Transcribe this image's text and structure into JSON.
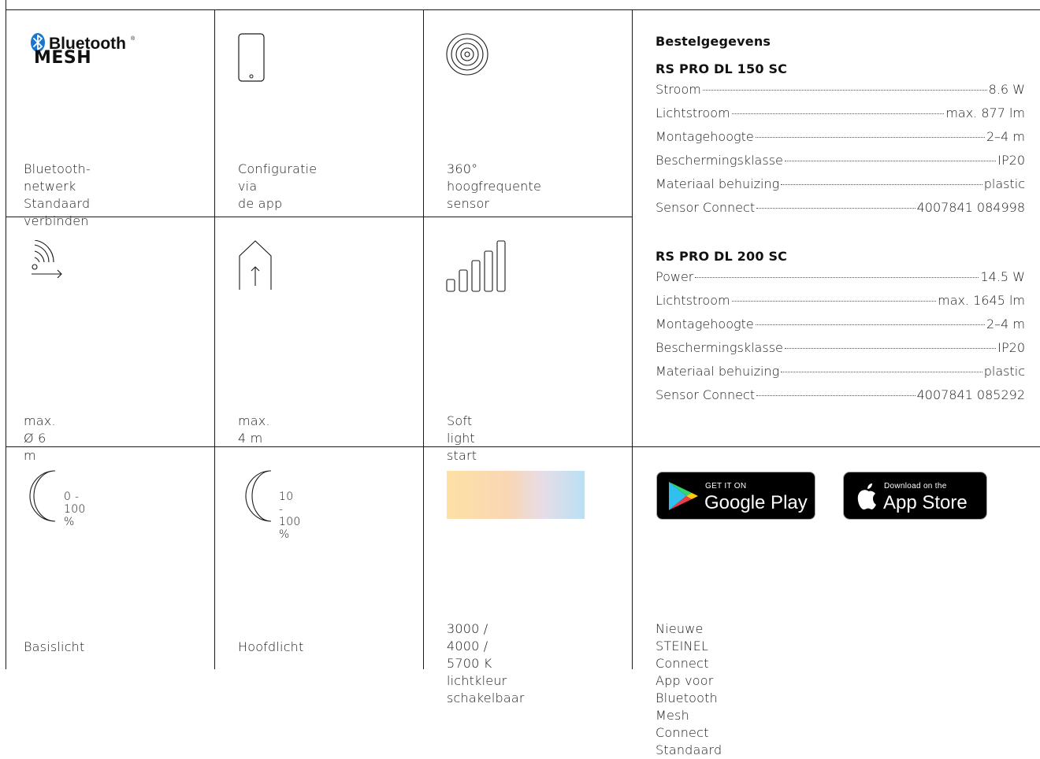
{
  "features": {
    "bluetooth": {
      "logo_word": "Bluetooth",
      "logo_reg": "®",
      "logo_mesh": "MESH",
      "caption": "Bluetooth-netwerk\nStandaard verbinden",
      "icon": "bluetooth-mesh-logo"
    },
    "app_config": {
      "caption": "Configuratie via\nde app",
      "icon": "smartphone-icon"
    },
    "sensor": {
      "caption": "360° hoogfrequente\nsensor",
      "icon": "hf-sensor-icon"
    },
    "range": {
      "caption": "max. Ø 6 m",
      "icon": "detection-range-icon"
    },
    "height": {
      "caption": "max. 4 m",
      "icon": "mounting-height-icon"
    },
    "soft_start": {
      "caption": "Soft light start",
      "icon": "soft-start-bars-icon"
    },
    "base_light": {
      "caption": "Basislicht",
      "range_label": "0 - 100 %",
      "icon": "moon-icon"
    },
    "main_light": {
      "caption": "Hoofdlicht",
      "range_label": "10 - 100 %",
      "icon": "moon-icon"
    },
    "color_temp": {
      "caption": "3000 / 4000 / 5700 K\nlichtkleur schakelbaar",
      "gradient_colors": [
        "#fde1a5",
        "#f9d6b5",
        "#e6dde8",
        "#b9e0f4"
      ]
    },
    "app_stores": {
      "google_small": "GET IT ON",
      "google_big": "Google Play",
      "apple_small": "Download on the",
      "apple_big": "App Store",
      "caption": "Nieuwe STEINEL Connect App voor\nBluetooth Mesh Connect Standaard"
    }
  },
  "order": {
    "title": "Bestelgegevens",
    "products": [
      {
        "name": "RS PRO DL 150 SC",
        "rows": [
          {
            "label": "Stroom",
            "value": "8.6 W"
          },
          {
            "label": "Lichtstroom",
            "value": "max. 877 lm"
          },
          {
            "label": "Montagehoogte",
            "value": "2–4 m"
          },
          {
            "label": "Beschermingsklasse",
            "value": "IP20"
          },
          {
            "label": "Materiaal behuizing",
            "value": "plastic"
          },
          {
            "label": "Sensor Connect",
            "value": "4007841 084998"
          }
        ]
      },
      {
        "name": "RS PRO DL 200 SC",
        "rows": [
          {
            "label": "Power",
            "value": "14.5 W"
          },
          {
            "label": "Lichtstroom",
            "value": "max. 1645 lm"
          },
          {
            "label": "Montagehoogte",
            "value": "2–4 m"
          },
          {
            "label": "Beschermingsklasse",
            "value": "IP20"
          },
          {
            "label": "Materiaal behuizing",
            "value": "plastic"
          },
          {
            "label": "Sensor Connect",
            "value": "4007841 085292"
          }
        ]
      }
    ]
  }
}
